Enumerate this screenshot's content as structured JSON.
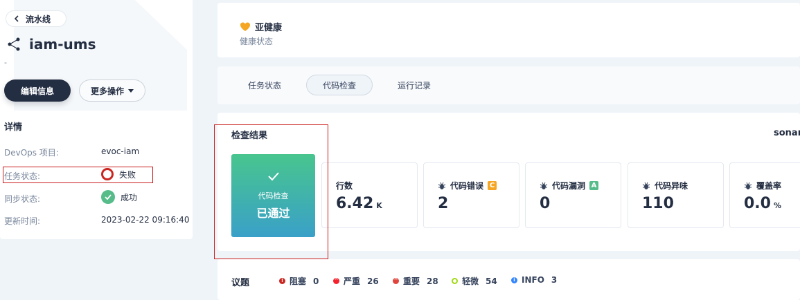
{
  "sidebar": {
    "back_label": "流水线",
    "title": "iam-ums",
    "description": "-",
    "edit_label": "编辑信息",
    "more_label": "更多操作",
    "details_heading": "详情",
    "details": [
      {
        "label": "DevOps 项目:",
        "value": "evoc-iam"
      },
      {
        "label": "任务状态:",
        "value": "失败"
      },
      {
        "label": "同步状态:",
        "value": "成功"
      },
      {
        "label": "更新时间:",
        "value": "2023-02-22 09:16:40"
      }
    ]
  },
  "health": {
    "title": "亚健康",
    "subtitle": "健康状态"
  },
  "tabs": [
    {
      "label": "任务状态",
      "active": false
    },
    {
      "label": "代码检查",
      "active": true
    },
    {
      "label": "运行记录",
      "active": false
    }
  ],
  "check": {
    "title": "检查结果",
    "provider": "sonar",
    "pass_line1": "代码检查",
    "pass_line2": "已通过",
    "metrics": [
      {
        "label": "行数",
        "value": "6.42",
        "unit": "K",
        "grade": null
      },
      {
        "label": "代码错误",
        "value": "2",
        "unit": "",
        "grade": "C"
      },
      {
        "label": "代码漏洞",
        "value": "0",
        "unit": "",
        "grade": "A"
      },
      {
        "label": "代码异味",
        "value": "110",
        "unit": "",
        "grade": null
      },
      {
        "label": "覆盖率",
        "value": "0.0",
        "unit": "%",
        "grade": null
      }
    ]
  },
  "issues": {
    "title": "议题",
    "items": [
      {
        "label": "阻塞",
        "count": "0",
        "color": "#ca2621"
      },
      {
        "label": "严重",
        "count": "26",
        "color": "#f5222d"
      },
      {
        "label": "重要",
        "count": "28",
        "color": "#e0443c"
      },
      {
        "label": "轻微",
        "count": "54",
        "color": "#a0d911"
      },
      {
        "label": "INFO",
        "count": "3",
        "color": "#3385ff"
      }
    ]
  },
  "colors": {
    "grade_A": "#55bc8a",
    "grade_C": "#f5a623",
    "fail": "#ca2621",
    "success": "#55bc8a"
  }
}
